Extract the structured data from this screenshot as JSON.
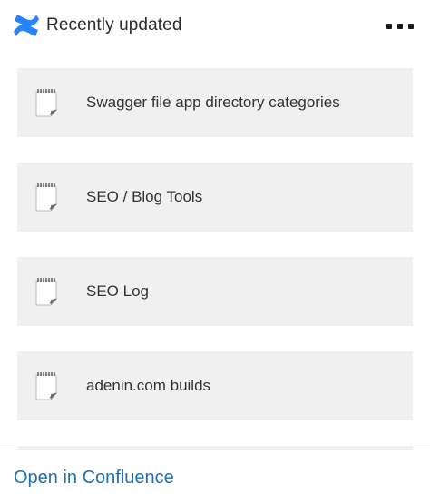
{
  "header": {
    "logo_icon": "confluence-logo-icon",
    "title": "Recently updated",
    "menu_icon": "more-options-icon"
  },
  "list": {
    "item_icon": "page-document-icon",
    "items": [
      {
        "label": "Swagger file app directory categories"
      },
      {
        "label": "SEO / Blog Tools"
      },
      {
        "label": "SEO Log"
      },
      {
        "label": "adenin.com builds"
      }
    ]
  },
  "footer": {
    "open_label": "Open in Confluence"
  },
  "colors": {
    "accent": "#1d6fb8",
    "logo": "#2684ff",
    "item_background": "#f0f0f0",
    "text": "#2b2b2b"
  }
}
